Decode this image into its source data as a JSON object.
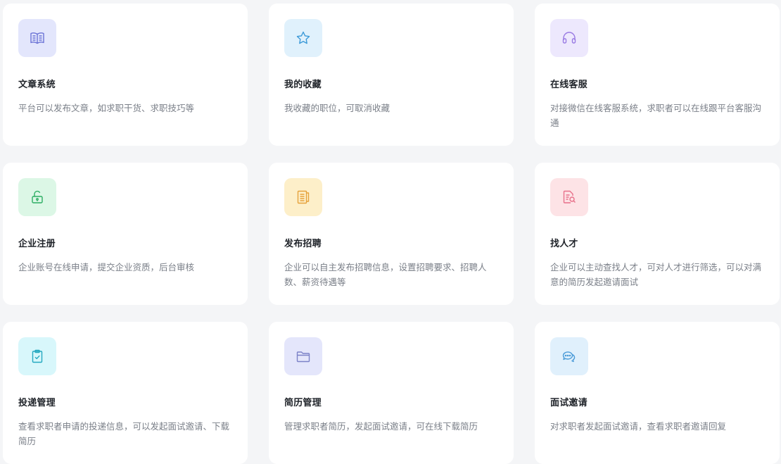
{
  "features": [
    {
      "title": "文章系统",
      "desc": "平台可以发布文章，如求职干货、求职技巧等",
      "icon": "open-book-icon",
      "icon_bg": "#e3e6fc",
      "icon_color": "#6b73d6"
    },
    {
      "title": "我的收藏",
      "desc": "我收藏的职位，可取消收藏",
      "icon": "star-icon",
      "icon_bg": "#e0f1fc",
      "icon_color": "#3c9ad8"
    },
    {
      "title": "在线客服",
      "desc": "对接微信在线客服系统，求职者可以在线跟平台客服沟通",
      "icon": "headset-icon",
      "icon_bg": "#ede8fd",
      "icon_color": "#9a7be3"
    },
    {
      "title": "企业注册",
      "desc": "企业账号在线申请，提交企业资质，后台审核",
      "icon": "unlock-icon",
      "icon_bg": "#dcf7e6",
      "icon_color": "#2dae63"
    },
    {
      "title": "发布招聘",
      "desc": "企业可以自主发布招聘信息，设置招聘要求、招聘人数、薪资待遇等",
      "icon": "notebook-icon",
      "icon_bg": "#fdefc9",
      "icon_color": "#e6a23c"
    },
    {
      "title": "找人才",
      "desc": "企业可以主动查找人才，可对人才进行筛选，可以对满意的简历发起邀请面试",
      "icon": "document-search-icon",
      "icon_bg": "#fde3e6",
      "icon_color": "#e8708a"
    },
    {
      "title": "投递管理",
      "desc": "查看求职者申请的投递信息，可以发起面试邀请、下载简历",
      "icon": "clipboard-check-icon",
      "icon_bg": "#d8f7fb",
      "icon_color": "#25a9c0"
    },
    {
      "title": "简历管理",
      "desc": "管理求职者简历，发起面试邀请，可在线下载简历",
      "icon": "folder-icon",
      "icon_bg": "#e4e6fb",
      "icon_color": "#7c82c8"
    },
    {
      "title": "面试邀请",
      "desc": "对求职者发起面试邀请，查看求职者邀请回复",
      "icon": "chat-bubbles-icon",
      "icon_bg": "#e0f0fc",
      "icon_color": "#4a9bd8"
    }
  ]
}
